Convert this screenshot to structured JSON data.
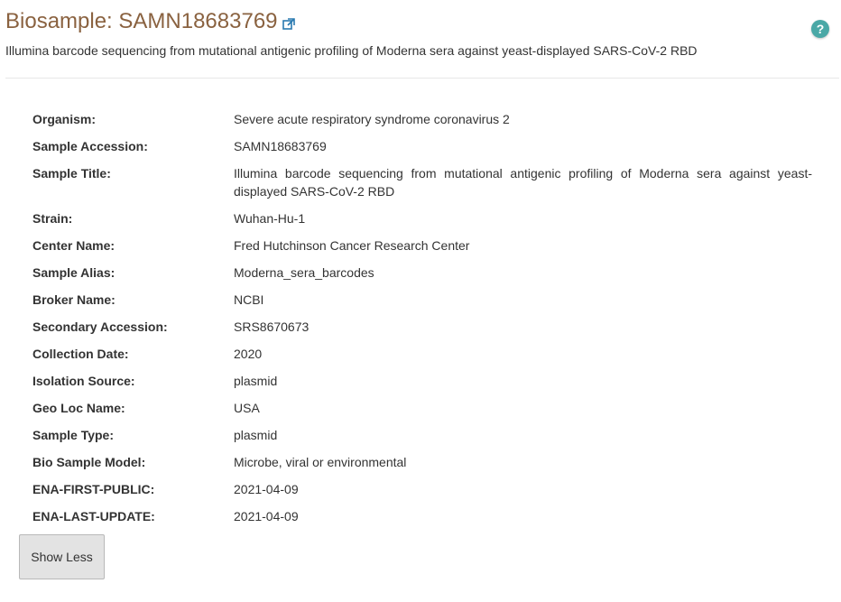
{
  "header": {
    "title": "Biosample: SAMN18683769",
    "subtitle": "Illumina barcode sequencing from mutational antigenic profiling of Moderna sera against yeast-displayed SARS-CoV-2 RBD",
    "help_glyph": "?"
  },
  "fields": [
    {
      "label": "Organism:",
      "value": "Severe acute respiratory syndrome coronavirus 2"
    },
    {
      "label": "Sample Accession:",
      "value": "SAMN18683769"
    },
    {
      "label": "Sample Title:",
      "value": "Illumina barcode sequencing from mutational antigenic profiling of Moderna sera against yeast-displayed SARS-CoV-2 RBD"
    },
    {
      "label": "Strain:",
      "value": "Wuhan-Hu-1"
    },
    {
      "label": "Center Name:",
      "value": "Fred Hutchinson Cancer Research Center"
    },
    {
      "label": "Sample Alias:",
      "value": "Moderna_sera_barcodes"
    },
    {
      "label": "Broker Name:",
      "value": "NCBI"
    },
    {
      "label": "Secondary Accession:",
      "value": "SRS8670673"
    },
    {
      "label": "Collection Date:",
      "value": "2020"
    },
    {
      "label": "Isolation Source:",
      "value": "plasmid"
    },
    {
      "label": "Geo Loc Name:",
      "value": "USA"
    },
    {
      "label": "Sample Type:",
      "value": "plasmid"
    },
    {
      "label": "Bio Sample Model:",
      "value": "Microbe, viral or environmental"
    },
    {
      "label": "ENA-FIRST-PUBLIC:",
      "value": "2021-04-09"
    },
    {
      "label": "ENA-LAST-UPDATE:",
      "value": "2021-04-09"
    }
  ],
  "show_less_button": "Show Less",
  "colors": {
    "title": "#8a6240",
    "help_badge": "#4aa8a6",
    "link_icon": "#2a7ab0"
  },
  "icons": {
    "external_link": "external-link-icon",
    "help": "help-icon"
  }
}
